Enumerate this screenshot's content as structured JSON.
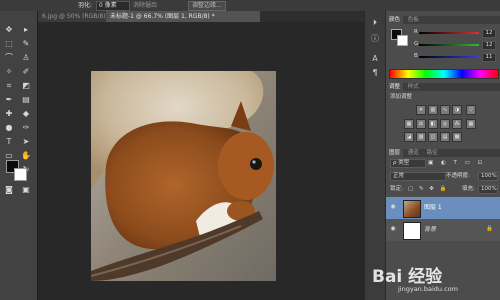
{
  "options_bar": {
    "field1": "羽化:",
    "field1_value": "0 像素",
    "antialias": "消除锯齿",
    "refine_edge": "调整边缘..."
  },
  "tabs": [
    {
      "label": "6.jpg @ 50% (RGB/8) *",
      "active": false
    },
    {
      "label": "未标题-1 @ 66.7% (图层 1, RGB/8) *",
      "active": true
    }
  ],
  "color_panel": {
    "tabs": [
      "颜色",
      "色板"
    ],
    "r_label": "R",
    "r_value": "12",
    "g_label": "G",
    "g_value": "12",
    "b_label": "B",
    "b_value": "11"
  },
  "adjust_panel": {
    "tabs": [
      "调整",
      "样式"
    ],
    "title": "添加调整"
  },
  "layers_panel": {
    "tabs": [
      "图层",
      "通道",
      "路径"
    ],
    "kind_filter": "ρ 类型",
    "blend_mode": "正常",
    "opacity_label": "不透明度:",
    "opacity_value": "100%",
    "lock_label": "锁定:",
    "fill_label": "填充:",
    "fill_value": "100%",
    "layers": [
      {
        "name": "图层 1",
        "selected": true
      },
      {
        "name": "背景",
        "selected": false
      }
    ]
  },
  "watermark": {
    "brand": "Bai 经验",
    "url": "jingyan.baidu.com"
  },
  "colors": {
    "panel_bg": "#4c4c4c",
    "canvas_bg": "#282828",
    "selection_blue": "#6a8fbf"
  }
}
